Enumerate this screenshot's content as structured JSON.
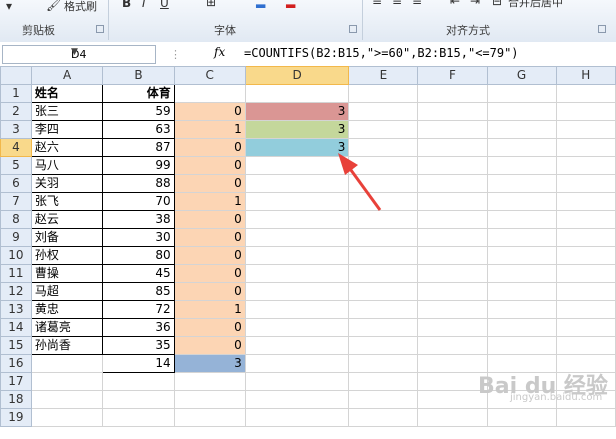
{
  "ribbon": {
    "format_painter_label": "格式刷",
    "groups": [
      "剪贴板",
      "字体",
      "对齐方式"
    ],
    "wrap_label": "合并后居中"
  },
  "formula_bar": {
    "cell_ref": "D4",
    "fx": "fx",
    "formula": "=COUNTIFS(B2:B15,\">=60\",B2:B15,\"<=79\")"
  },
  "columns": [
    "A",
    "B",
    "C",
    "D",
    "E",
    "F",
    "G",
    "H"
  ],
  "rows": [
    {
      "n": "1",
      "a": "姓名",
      "b": "体育",
      "c": "",
      "d": ""
    },
    {
      "n": "2",
      "a": "张三",
      "b": "59",
      "c": "0",
      "d": "3"
    },
    {
      "n": "3",
      "a": "李四",
      "b": "63",
      "c": "1",
      "d": "3"
    },
    {
      "n": "4",
      "a": "赵六",
      "b": "87",
      "c": "0",
      "d": "3"
    },
    {
      "n": "5",
      "a": "马八",
      "b": "99",
      "c": "0",
      "d": ""
    },
    {
      "n": "6",
      "a": "关羽",
      "b": "88",
      "c": "0",
      "d": ""
    },
    {
      "n": "7",
      "a": "张飞",
      "b": "70",
      "c": "1",
      "d": ""
    },
    {
      "n": "8",
      "a": "赵云",
      "b": "38",
      "c": "0",
      "d": ""
    },
    {
      "n": "9",
      "a": "刘备",
      "b": "30",
      "c": "0",
      "d": ""
    },
    {
      "n": "10",
      "a": "孙权",
      "b": "80",
      "c": "0",
      "d": ""
    },
    {
      "n": "11",
      "a": "曹操",
      "b": "45",
      "c": "0",
      "d": ""
    },
    {
      "n": "12",
      "a": "马超",
      "b": "85",
      "c": "0",
      "d": ""
    },
    {
      "n": "13",
      "a": "黄忠",
      "b": "72",
      "c": "1",
      "d": ""
    },
    {
      "n": "14",
      "a": "诸葛亮",
      "b": "36",
      "c": "0",
      "d": ""
    },
    {
      "n": "15",
      "a": "孙尚香",
      "b": "35",
      "c": "0",
      "d": ""
    },
    {
      "n": "16",
      "a": "",
      "b": "14",
      "c": "3",
      "d": ""
    },
    {
      "n": "17",
      "a": "",
      "b": "",
      "c": "",
      "d": ""
    },
    {
      "n": "18",
      "a": "",
      "b": "",
      "c": "",
      "d": ""
    },
    {
      "n": "19",
      "a": "",
      "b": "",
      "c": "",
      "d": ""
    }
  ],
  "watermark": {
    "logo": "Bai du 经验",
    "url": "jingyan.baidu.com"
  },
  "colors": {
    "peach": "#fcd5b4",
    "red": "#da9694",
    "green": "#c4d79b",
    "cyan": "#92cddc",
    "blue": "#95b3d7",
    "arrow": "#e8413a"
  }
}
